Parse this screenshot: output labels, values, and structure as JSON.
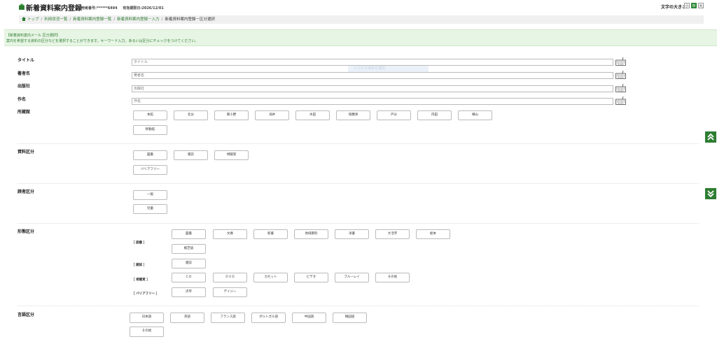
{
  "header": {
    "title": "新着資料案内登録",
    "user_no": "利用者番号:******6494",
    "expiry": "有効期限日:2026/12/01",
    "font_size_label": "文字の大きさ",
    "font_sizes": [
      "小",
      "中",
      "大"
    ]
  },
  "breadcrumb": [
    "トップ",
    "利用状況一覧",
    "新着資料案内登録一覧",
    "新着資料案内登録－入力",
    "新着資料案内登録－区分選択"
  ],
  "notice": {
    "title": "【新着資料案内メール 区分選択】",
    "text": "案内を希望する資料の区分などを選択することができます。キーワード入力、あるいは区分にチェックをつけてください。"
  },
  "fields": {
    "title": {
      "label": "タイトル",
      "placeholder": "タイトル"
    },
    "author": {
      "label": "著者名",
      "placeholder": "著者名"
    },
    "publisher": {
      "label": "出版社",
      "placeholder": "出版社"
    },
    "work": {
      "label": "作名",
      "placeholder": "作名"
    }
  },
  "ghost_text": "入力する項目を選択",
  "library": {
    "label": "所蔵館",
    "items": [
      "本館",
      "北分",
      "東小野",
      "浅井",
      "水田",
      "瑞穂津",
      "戸分",
      "内田",
      "横山",
      "移動館"
    ]
  },
  "material": {
    "label": "資料区分",
    "items": [
      "図書",
      "雑誌",
      "視聴覚",
      "バリアフリー"
    ]
  },
  "audience": {
    "label": "読者区分",
    "items": [
      "一般",
      "児童"
    ]
  },
  "form": {
    "label": "形態区分",
    "groups": [
      {
        "name": "［ 図書 ］",
        "items": [
          "図書",
          "文庫",
          "新書",
          "地域資料",
          "洋書",
          "大活字",
          "絵本",
          "紙芝居"
        ]
      },
      {
        "name": "［ 雑誌 ］",
        "items": [
          "雑誌"
        ]
      },
      {
        "name": "［ 視聴覚 ］",
        "items": [
          "ＣＤ",
          "ＤＶＤ",
          "カセット",
          "ビデオ",
          "ブルーレイ",
          "その他"
        ]
      },
      {
        "name": "［ バリアフリー ］",
        "items": [
          "点字",
          "デイジー"
        ]
      }
    ]
  },
  "language": {
    "label": "言語区分",
    "items": [
      "日本語",
      "英語",
      "フランス語",
      "ポルトガル語",
      "中国語",
      "韓国語",
      "その他"
    ]
  },
  "side_nav": {
    "up": "page-up",
    "down": "page-down"
  }
}
